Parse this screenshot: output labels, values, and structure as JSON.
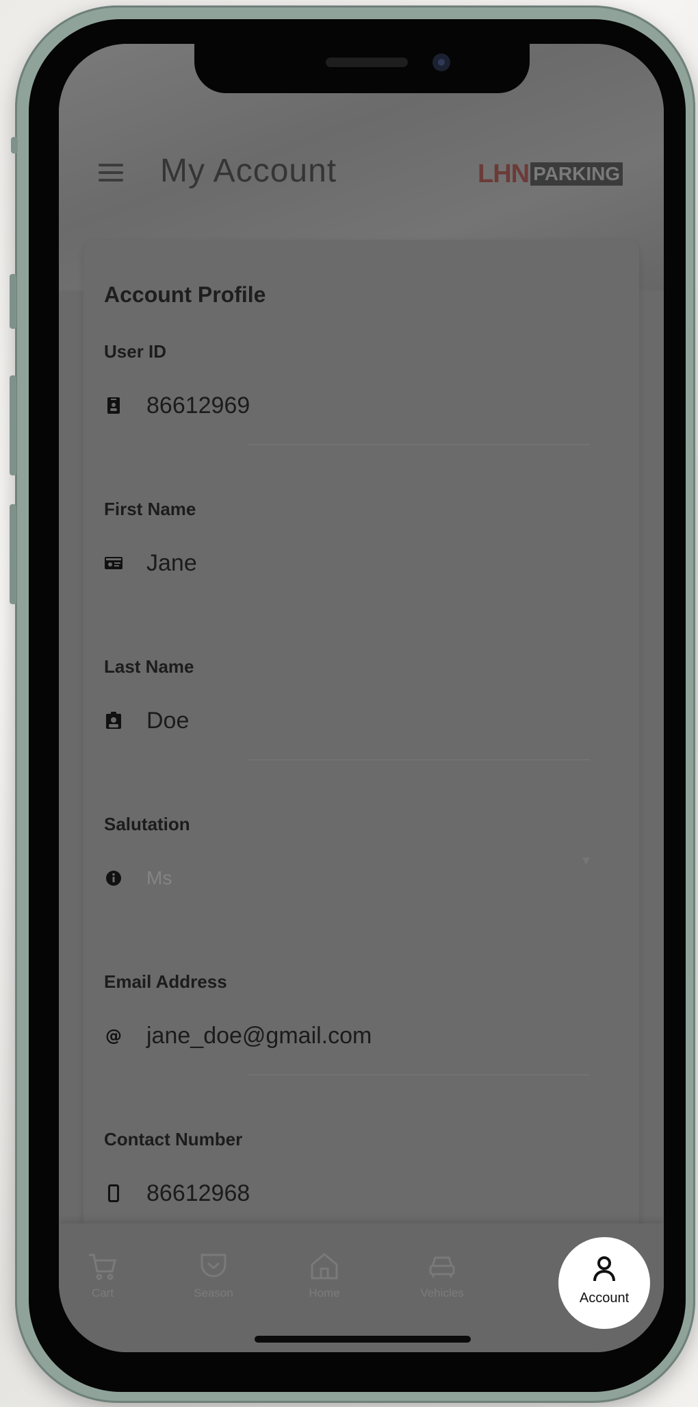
{
  "header": {
    "title": "My Account",
    "logo_part1": "LHN",
    "logo_part2": "PARKING"
  },
  "profile": {
    "title": "Account Profile",
    "fields": [
      {
        "label": "User ID",
        "value": "86612969",
        "icon": "id-badge-icon"
      },
      {
        "label": "First Name",
        "value": "Jane",
        "icon": "id-card-icon"
      },
      {
        "label": "Last Name",
        "value": "Doe",
        "icon": "clipboard-user-icon"
      },
      {
        "label": "Salutation",
        "value": "Ms",
        "icon": "info-circle-icon"
      },
      {
        "label": "Email Address",
        "value": "jane_doe@gmail.com",
        "icon": "at-icon"
      },
      {
        "label": "Contact Number",
        "value": "86612968",
        "icon": "phone-icon"
      }
    ]
  },
  "nav": {
    "items": [
      {
        "label": "Cart",
        "icon": "cart-icon"
      },
      {
        "label": "Season",
        "icon": "pocket-icon"
      },
      {
        "label": "Home",
        "icon": "home-icon"
      },
      {
        "label": "Vehicles",
        "icon": "car-icon"
      }
    ],
    "active": {
      "label": "Account",
      "icon": "user-icon"
    }
  },
  "colors": {
    "overlay": "#6a6a6a",
    "logo_red": "#6b3b38",
    "active_tab_bg": "#ffffff"
  }
}
